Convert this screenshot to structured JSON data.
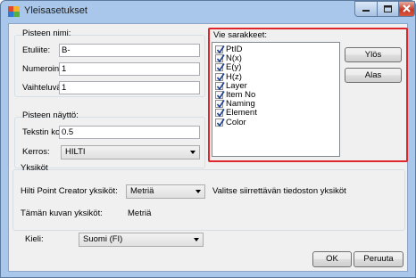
{
  "window": {
    "title": "Yleisasetukset"
  },
  "point_name": {
    "group_label": "Pisteen nimi:",
    "prefix_label": "Etuliite:",
    "prefix_value": "B-",
    "numbering_label": "Numerointi:",
    "numbering_value": "1",
    "step_label": "Vaihteluväli:",
    "step_value": "1"
  },
  "point_display": {
    "group_label": "Pisteen näyttö:",
    "text_size_label": "Tekstin koko:",
    "text_size_value": "0.5",
    "layer_label": "Kerros:",
    "layer_value": "HILTI"
  },
  "export_columns": {
    "group_label": "Vie sarakkeet:",
    "items": [
      {
        "label": "PtID",
        "checked": true
      },
      {
        "label": "N(x)",
        "checked": true
      },
      {
        "label": "E(y)",
        "checked": true
      },
      {
        "label": "H(z)",
        "checked": true
      },
      {
        "label": "Layer",
        "checked": true
      },
      {
        "label": "Item No",
        "checked": true
      },
      {
        "label": "Naming",
        "checked": true
      },
      {
        "label": "Element",
        "checked": true
      },
      {
        "label": "Color",
        "checked": true
      }
    ],
    "up_label": "Ylös",
    "down_label": "Alas"
  },
  "units": {
    "group_label": "Yksiköt",
    "hpc_units_label": "Hilti Point Creator yksiköt:",
    "hpc_units_value": "Metriä",
    "hint": "Valitse siirrettävän tiedoston yksiköt",
    "drawing_units_label": "Tämän kuvan yksiköt:",
    "drawing_units_value": "Metriä"
  },
  "language": {
    "label": "Kieli:",
    "value": "Suomi (FI)"
  },
  "footer": {
    "ok_label": "OK",
    "cancel_label": "Peruuta"
  },
  "colors": {
    "highlight": "#e0262d",
    "titlebar": "#a9c7ea",
    "dialog_bg": "#f0f0f0"
  }
}
